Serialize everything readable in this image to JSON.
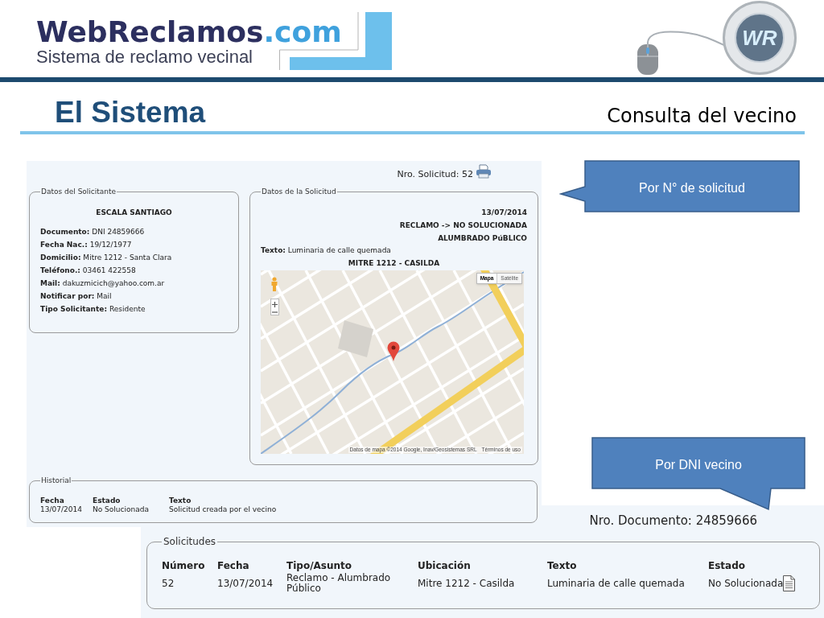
{
  "header": {
    "logo": {
      "name": "WebReclamos",
      "domain": ".com"
    },
    "tagline": "Sistema de reclamo vecinal",
    "badge": "WR"
  },
  "slide": {
    "title": "El Sistema",
    "subtitle": "Consulta del vecino"
  },
  "request_view": {
    "request_number": "Nro. Solicitud: 52",
    "applicant": {
      "legend": "Datos del Solicitante",
      "name": "ESCALA SANTIAGO",
      "details": [
        "**Documento:** DNI 24859666",
        "**Fecha Nac.:** 19/12/1977",
        "**Domicilio:** Mitre 1212 - Santa Clara",
        "**Teléfono.:** 03461 422558",
        "**Mail:** dakuzmicich@yahoo.com.ar",
        "**Notificar por:** Mail",
        "**Tipo Solicitante:** Residente"
      ]
    },
    "request": {
      "legend": "Datos de la Solicitud",
      "summary": [
        "13/07/2014",
        "RECLAMO -> NO SOLUCIONADA",
        "ALUMBRADO PúBLICO"
      ],
      "text": "**Texto:** Luminaria de calle quemada",
      "address": "MITRE 1212 - CASILDA",
      "map": {
        "map_types": [
          {
            "label": "Mapa",
            "selected": true
          },
          {
            "label": "Satélite",
            "selected": false
          }
        ],
        "attribution": "Datos de mapa ©2014 Google, Inav/Geosistemas SRL",
        "terms": "Términos de uso"
      }
    },
    "history": {
      "legend": "Historial",
      "columns": [
        "Fecha",
        "Estado",
        "Texto"
      ],
      "rows": [
        {
          "cells": [
            "13/07/2014",
            "No Solucionada",
            "Solicitud creada por el vecino"
          ]
        }
      ]
    }
  },
  "document_view": {
    "document_number": "Nro. Documento: 24859666",
    "requests": {
      "legend": "Solicitudes",
      "columns": [
        "Número",
        "Fecha",
        "Tipo/Asunto",
        "Ubicación",
        "Texto",
        "Estado"
      ],
      "rows": [
        {
          "cells": [
            "52",
            "13/07/2014",
            "Reclamo - Alumbrado Público",
            "Mitre 1212 - Casilda",
            "Luminaria de calle quemada",
            "No Solucionada"
          ]
        }
      ]
    }
  },
  "callouts": [
    {
      "kind": "left",
      "text": "Por N° de solicitud"
    },
    {
      "kind": "down",
      "text": "Por DNI vecino"
    }
  ]
}
